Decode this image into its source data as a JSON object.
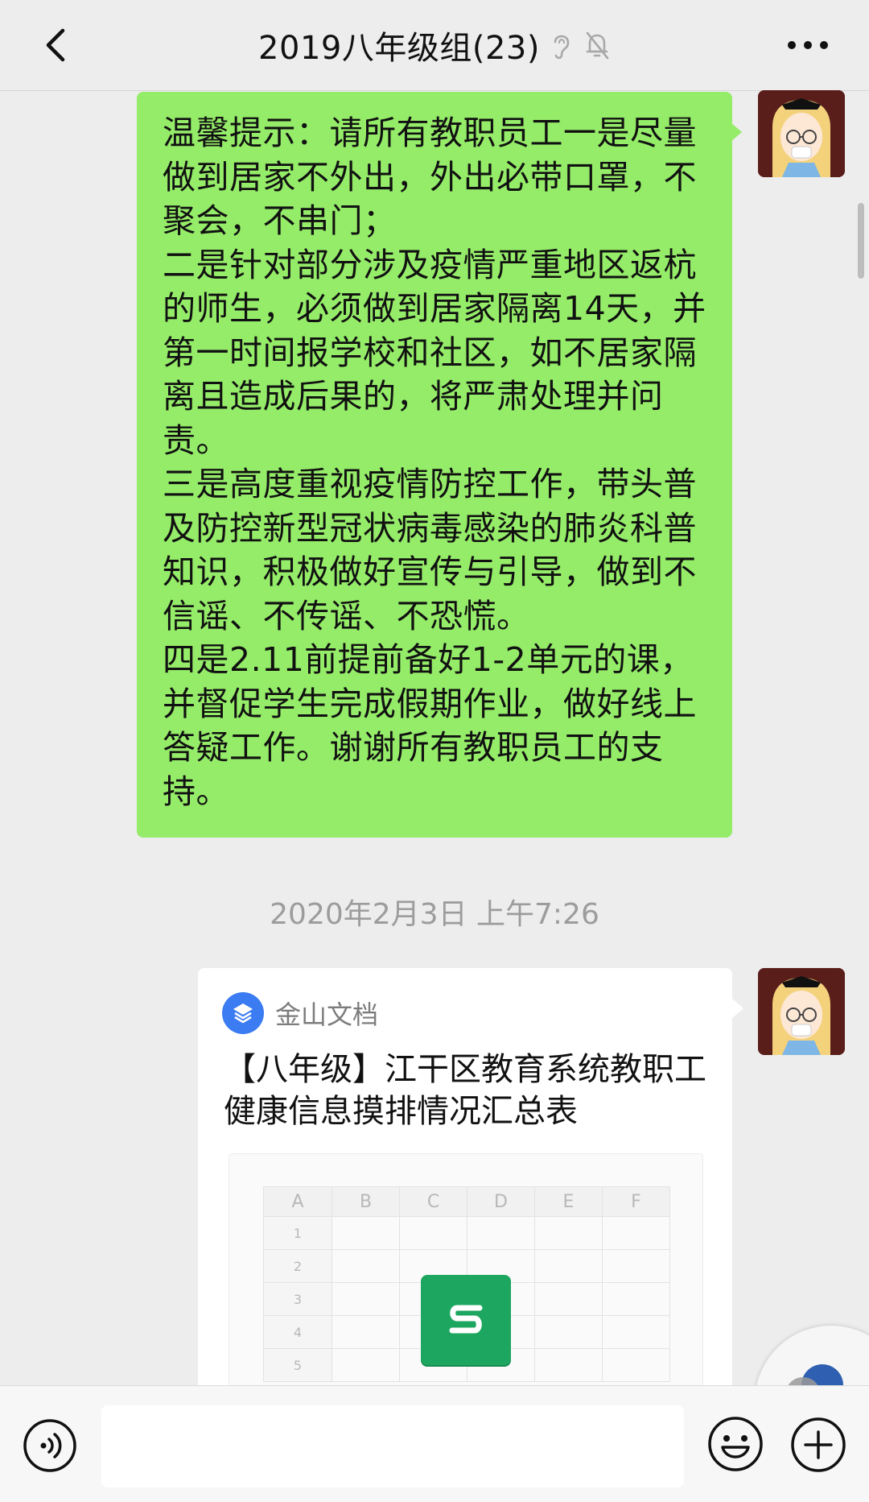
{
  "header": {
    "title": "2019八年级组(23)",
    "icons": [
      "back-icon",
      "ear-icon",
      "mute-bell-icon",
      "more-icon"
    ]
  },
  "messages": [
    {
      "type": "text",
      "text": "温馨提示：请所有教职员工一是尽量做到居家不外出，外出必带口罩，不聚会，不串门；\n二是针对部分涉及疫情严重地区返杭的师生，必须做到居家隔离14天，并第一时间报学校和社区，如不居家隔离且造成后果的，将严肃处理并问责。\n三是高度重视疫情防控工作，带头普及防控新型冠状病毒感染的肺炎科普知识，积极做好宣传与引导，做到不信谣、不传谣、不恐慌。\n四是2.11前提前备好1-2单元的课，并督促学生完成假期作业，做好线上答疑工作。谢谢所有教职员工的支持。"
    },
    {
      "type": "timestamp",
      "text": "2020年2月3日 上午7:26"
    },
    {
      "type": "card",
      "source": "金山文档",
      "title": "【八年级】江干区教育系统教职工健康信息摸排情况汇总表",
      "sheet": {
        "columns": [
          "A",
          "B",
          "C",
          "D",
          "E",
          "F"
        ],
        "rows": [
          "1",
          "2",
          "3",
          "4",
          "5"
        ]
      }
    }
  ],
  "colors": {
    "bubble": "#95ec69",
    "background": "#ededed",
    "sheet_badge": "#1da660",
    "source_logo": "#3b7cf3"
  }
}
